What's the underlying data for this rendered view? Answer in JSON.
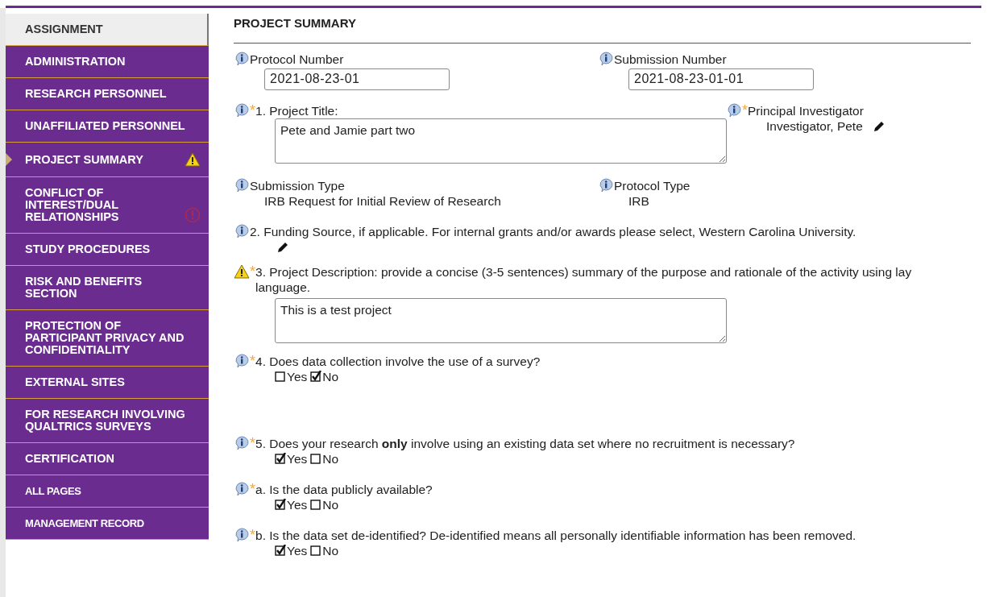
{
  "sidebar": {
    "items": [
      {
        "label": "ASSIGNMENT",
        "kind": "light",
        "selected": false,
        "warning": false,
        "error": false
      },
      {
        "label": "ADMINISTRATION",
        "kind": "page",
        "selected": false,
        "warning": false,
        "error": false
      },
      {
        "label": "RESEARCH PERSONNEL",
        "kind": "page",
        "selected": false,
        "warning": false,
        "error": false
      },
      {
        "label": "UNAFFILIATED PERSONNEL",
        "kind": "page",
        "selected": false,
        "warning": false,
        "error": false
      },
      {
        "label": "PROJECT SUMMARY",
        "kind": "page",
        "selected": true,
        "warning": true,
        "error": false
      },
      {
        "label": "CONFLICT OF INTEREST/DUAL RELATIONSHIPS",
        "kind": "page",
        "selected": false,
        "warning": false,
        "error": true
      },
      {
        "label": "STUDY PROCEDURES",
        "kind": "page",
        "selected": false,
        "warning": false,
        "error": false
      },
      {
        "label": "RISK AND BENEFITS SECTION",
        "kind": "page",
        "selected": false,
        "warning": false,
        "error": false
      },
      {
        "label": "PROTECTION OF PARTICIPANT PRIVACY AND CONFIDENTIALITY",
        "kind": "page",
        "selected": false,
        "warning": false,
        "error": false
      },
      {
        "label": "EXTERNAL SITES",
        "kind": "page",
        "selected": false,
        "warning": false,
        "error": false
      },
      {
        "label": "FOR RESEARCH INVOLVING QUALTRICS SURVEYS",
        "kind": "page",
        "selected": false,
        "warning": false,
        "error": false
      },
      {
        "label": "CERTIFICATION",
        "kind": "page",
        "selected": false,
        "warning": false,
        "error": false
      },
      {
        "label": "ALL PAGES",
        "kind": "small",
        "selected": false,
        "warning": false,
        "error": false
      },
      {
        "label": "MANAGEMENT RECORD",
        "kind": "small",
        "selected": false,
        "warning": false,
        "error": false
      }
    ]
  },
  "form": {
    "title": "PROJECT SUMMARY",
    "number_fields": [
      {
        "label": "Protocol Number",
        "value": "2021-08-23-01"
      },
      {
        "label": "Submission Number",
        "value": "2021-08-23-01-01"
      }
    ],
    "project_title": {
      "label": "1. Project Title:",
      "marker": "*",
      "value": "Pete and Jamie part two"
    },
    "principal_investigator": {
      "label": "Principal Investigator",
      "marker": "*",
      "value": "Investigator, Pete"
    },
    "type_fields": [
      {
        "label": "Submission Type",
        "value": "IRB Request for Initial Review of Research"
      },
      {
        "label": "Protocol Type",
        "value": "IRB"
      }
    ],
    "questions": [
      {
        "kind": "edit",
        "warning": false,
        "label": "2. Funding Source, if applicable. For internal grants and/or awards please select, Western Carolina University."
      },
      {
        "kind": "textarea",
        "warning": true,
        "marker": "*",
        "label": "3. Project Description: provide a concise (3-5 sentences) summary of the purpose and rationale of the activity using lay language.",
        "value": "This is a test project"
      },
      {
        "kind": "choice",
        "warning": false,
        "marker": "*",
        "label": "4. Does data collection involve the use of a survey?",
        "options": [
          {
            "label": "Yes",
            "checked": false
          },
          {
            "label": "No",
            "checked": true
          }
        ]
      }
    ],
    "follow_up_questions": [
      {
        "kind": "choice",
        "warning": false,
        "marker": "*",
        "label": "5. Does your research **only** involve using an existing data set where no recruitment is necessary?",
        "options": [
          {
            "label": "Yes",
            "checked": true
          },
          {
            "label": "No",
            "checked": false
          }
        ]
      },
      {
        "kind": "choice",
        "warning": false,
        "marker": "*",
        "label": "a. Is the data publicly available?",
        "options": [
          {
            "label": "Yes",
            "checked": true
          },
          {
            "label": "No",
            "checked": false
          }
        ]
      },
      {
        "kind": "choice",
        "warning": false,
        "marker": "*",
        "label": "b. Is the data set de-identified? De-identified means all personally identifiable information has been removed.",
        "options": [
          {
            "label": "Yes",
            "checked": true
          },
          {
            "label": "No",
            "checked": false
          }
        ]
      }
    ]
  }
}
